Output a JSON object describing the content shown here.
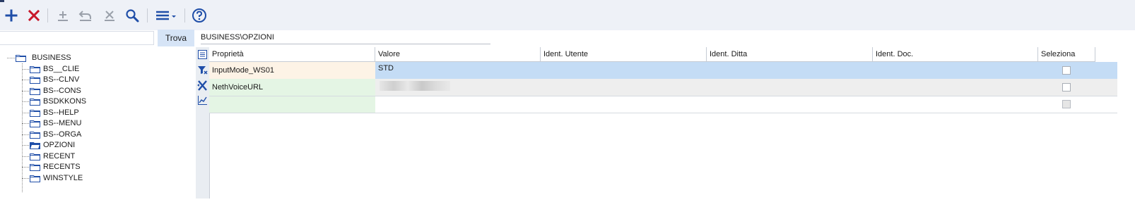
{
  "toolbar": {
    "icons": [
      "add-icon",
      "delete-icon",
      "insert-icon",
      "undo-icon",
      "remove-icon",
      "search-icon",
      "menu-icon",
      "help-icon"
    ]
  },
  "search": {
    "value": "",
    "placeholder": "",
    "button_label": "Trova"
  },
  "path": "BUSINESS\\OPZIONI",
  "tree": {
    "root": "BUSINESS",
    "items": [
      {
        "label": "BS__CLIE",
        "open": false
      },
      {
        "label": "BS--CLNV",
        "open": false
      },
      {
        "label": "BS--CONS",
        "open": false
      },
      {
        "label": "BSDKKONS",
        "open": false
      },
      {
        "label": "BS--HELP",
        "open": false
      },
      {
        "label": "BS--MENU",
        "open": false
      },
      {
        "label": "BS--ORGA",
        "open": false
      },
      {
        "label": "OPZIONI",
        "open": true
      },
      {
        "label": "RECENT",
        "open": false
      },
      {
        "label": "RECENTS",
        "open": false
      },
      {
        "label": "WINSTYLE",
        "open": false
      }
    ]
  },
  "grid": {
    "columns": [
      "Proprietà",
      "Valore",
      "Ident. Utente",
      "Ident. Ditta",
      "Ident. Doc.",
      "Seleziona"
    ],
    "rows": [
      {
        "proprieta": "InputMode_WS01",
        "valore": "STD",
        "utente": "",
        "ditta": "",
        "doc": "",
        "selected": true
      },
      {
        "proprieta": "NethVoiceURL",
        "valore": "",
        "utente": "",
        "ditta": "",
        "doc": "",
        "selected": false
      },
      {
        "proprieta": "",
        "valore": "",
        "utente": "",
        "ditta": "",
        "doc": "",
        "selected": false
      }
    ],
    "side_icons": [
      "list-icon",
      "filter-icon",
      "clear-filter-icon",
      "chart-icon"
    ]
  },
  "colors": {
    "toolbar_bg": "#eef1f7",
    "accent_blue": "#1f4ea8",
    "delete_red": "#c8182a",
    "selected_row": "#c4dcf5",
    "property_cell_selected": "#fdf3e6",
    "property_cell": "#e4f5e4"
  }
}
